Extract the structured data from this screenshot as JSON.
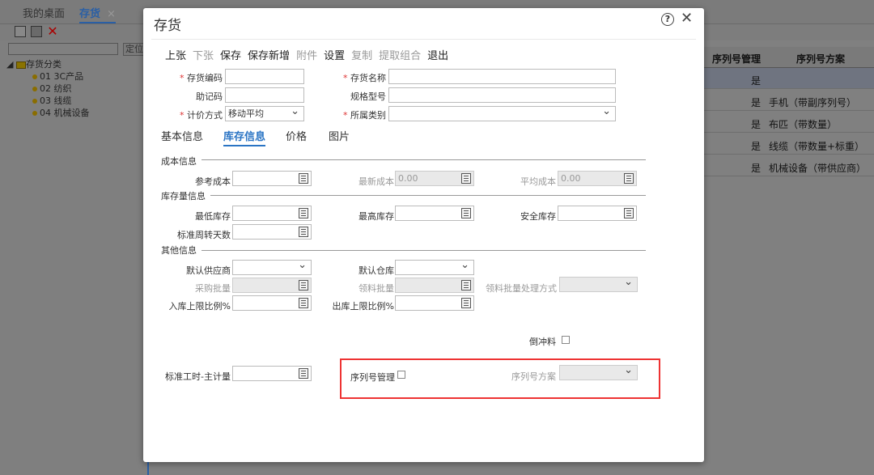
{
  "topbar": {
    "tab_desktop": "我的桌面",
    "tab_inventory": "存货",
    "tab_close": "×"
  },
  "toolbar": {
    "icons": [
      "new-doc-icon",
      "edit-icon",
      "delete-icon"
    ]
  },
  "left": {
    "search_placeholder": "",
    "locate": "定位",
    "root": "存货分类",
    "items": [
      "01 3C产品",
      "02 纺织",
      "03 线缆",
      "04 机械设备"
    ]
  },
  "grid": {
    "headers": [
      "序列号管理",
      "序列号方案"
    ],
    "rows": [
      [
        "是",
        ""
      ],
      [
        "是",
        "手机（带副序列号）"
      ],
      [
        "是",
        "布匹（带数量）"
      ],
      [
        "是",
        "线缆（带数量+标重）"
      ],
      [
        "是",
        "机械设备（带供应商）"
      ]
    ]
  },
  "dialog": {
    "title": "存货",
    "help": "?",
    "close": "✕",
    "buttons": [
      {
        "label": "上张",
        "enabled": true
      },
      {
        "label": "下张",
        "enabled": false
      },
      {
        "label": "保存",
        "enabled": true
      },
      {
        "label": "保存新增",
        "enabled": true
      },
      {
        "label": "附件",
        "enabled": false
      },
      {
        "label": "设置",
        "enabled": true
      },
      {
        "label": "复制",
        "enabled": false
      },
      {
        "label": "提取组合",
        "enabled": false
      },
      {
        "label": "退出",
        "enabled": true
      }
    ],
    "fields": {
      "code_label": "存货编码",
      "name_label": "存货名称",
      "mnemonic_label": "助记码",
      "spec_label": "规格型号",
      "pricing_label": "计价方式",
      "pricing_value": "移动平均",
      "category_label": "所属类别"
    },
    "subtabs": [
      "基本信息",
      "库存信息",
      "价格",
      "图片"
    ],
    "cost": {
      "section": "成本信息",
      "ref_cost": "参考成本",
      "latest_cost": "最新成本",
      "latest_value": "0.00",
      "avg_cost": "平均成本",
      "avg_value": "0.00"
    },
    "stock": {
      "section": "库存量信息",
      "min": "最低库存",
      "max": "最高库存",
      "safety": "安全库存",
      "turnover": "标准周转天数"
    },
    "other": {
      "section": "其他信息",
      "supplier": "默认供应商",
      "warehouse": "默认仓库",
      "purchase_batch": "采购批量",
      "pick_batch": "领料批量",
      "pick_method": "领料批量处理方式",
      "in_limit": "入库上限比例%",
      "out_limit": "出库上限比例%",
      "backflush": "倒冲料",
      "std_hours": "标准工时-主计量",
      "serial_mgmt": "序列号管理",
      "serial_scheme": "序列号方案"
    }
  }
}
